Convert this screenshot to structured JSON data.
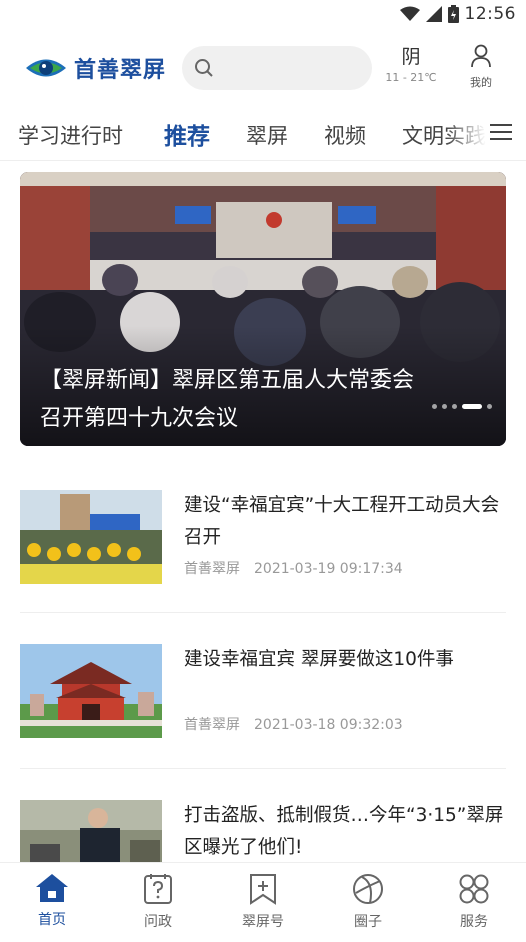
{
  "status_bar": {
    "time": "12:56",
    "icons": [
      "wifi-icon",
      "signal-icon",
      "battery-icon"
    ]
  },
  "header": {
    "logo_text": "首善翠屏",
    "search": {
      "placeholder": "",
      "icon": "search-icon"
    },
    "weather": {
      "condition": "阴",
      "temperature": "11 - 21℃"
    },
    "mine_label": "我的"
  },
  "tabs": [
    {
      "label": "学习进行时"
    },
    {
      "label": "推荐",
      "active": true
    },
    {
      "label": "翠屏"
    },
    {
      "label": "视频"
    },
    {
      "label": "文明实践"
    }
  ],
  "banner": {
    "title": "【翠屏新闻】翠屏区第五届人大常委会召开第四十九次会议",
    "slide_count": 5,
    "active_slide": 4
  },
  "news": [
    {
      "title": "建设“幸福宜宾”十大工程开工动员大会召开",
      "source": "首善翠屏",
      "time": "2021-03-19 09:17:34"
    },
    {
      "title": "建设幸福宜宾 翠屏要做这10件事",
      "source": "首善翠屏",
      "time": "2021-03-18 09:32:03"
    },
    {
      "title": "打击盗版、抵制假货…今年“3·15”翠屏区曝光了他们!",
      "source": "",
      "time": ""
    }
  ],
  "bottom_nav": [
    {
      "label": "首页",
      "icon": "home-icon",
      "active": true
    },
    {
      "label": "问政",
      "icon": "question-icon"
    },
    {
      "label": "翠屏号",
      "icon": "bookmark-plus-icon"
    },
    {
      "label": "圈子",
      "icon": "circle-icon"
    },
    {
      "label": "服务",
      "icon": "grid-icon"
    }
  ],
  "colors": {
    "brand": "#1d4f9e",
    "text": "#222222",
    "meta": "#999999"
  }
}
